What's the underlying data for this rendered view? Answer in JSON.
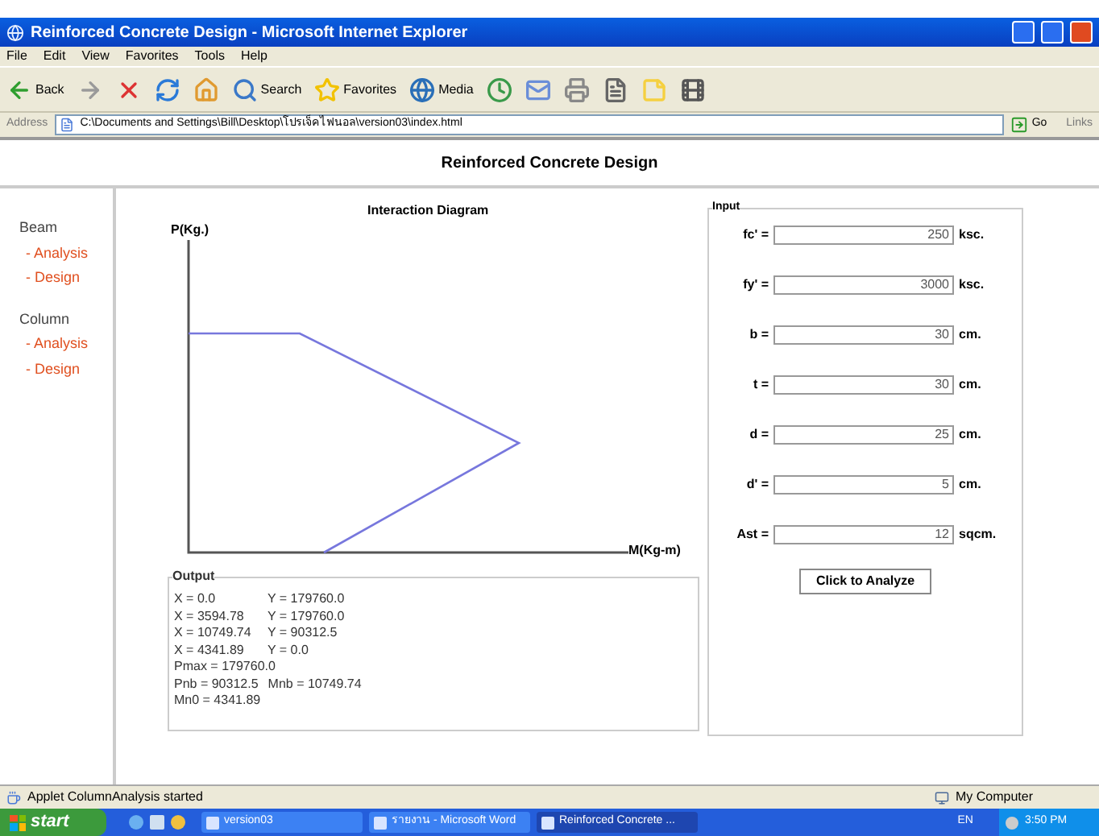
{
  "window": {
    "title": "Reinforced Concrete Design - Microsoft Internet Explorer"
  },
  "menu": [
    "File",
    "Edit",
    "View",
    "Favorites",
    "Tools",
    "Help"
  ],
  "toolbar": [
    {
      "kind": "back",
      "label": "Back"
    },
    {
      "kind": "forward"
    },
    {
      "kind": "stop"
    },
    {
      "kind": "refresh"
    },
    {
      "kind": "home"
    },
    {
      "kind": "search",
      "label": "Search"
    },
    {
      "kind": "favorites",
      "label": "Favorites"
    },
    {
      "kind": "media",
      "label": "Media"
    },
    {
      "kind": "history"
    },
    {
      "kind": "mail"
    },
    {
      "kind": "print"
    },
    {
      "kind": "edit"
    },
    {
      "kind": "note"
    },
    {
      "kind": "film"
    }
  ],
  "address": {
    "label": "Address",
    "value": "C:\\Documents and Settings\\Bill\\Desktop\\โปรเจ็คไฟนอล\\version03\\index.html",
    "go": "Go",
    "links": "Links"
  },
  "page": {
    "header": "Reinforced Concrete Design"
  },
  "sidebar": [
    {
      "title": "Beam",
      "items": [
        "- Analysis",
        "- Design"
      ]
    },
    {
      "title": "Column",
      "items": [
        "- Analysis",
        "- Design"
      ]
    }
  ],
  "diagram": {
    "title": "Interaction Diagram",
    "y_label": "P(Kg.)",
    "x_label": "M(Kg-m)"
  },
  "output": {
    "title": "Output",
    "rows": [
      [
        "X = 0.0",
        "Y = 179760.0"
      ],
      [
        "X = 3594.78",
        "Y = 179760.0"
      ],
      [
        "X = 10749.74",
        "Y = 90312.5"
      ],
      [
        "X = 4341.89",
        "Y = 0.0"
      ],
      [
        "Pmax = 179760.0"
      ],
      [
        "Pnb = 90312.5",
        "Mnb = 10749.74"
      ],
      [
        "Mn0 = 4341.89"
      ]
    ]
  },
  "input": {
    "title": "Input",
    "fields": [
      {
        "label": "fc' =",
        "value": "250",
        "unit": "ksc."
      },
      {
        "label": "fy' =",
        "value": "3000",
        "unit": "ksc."
      },
      {
        "label": "b =",
        "value": "30",
        "unit": "cm."
      },
      {
        "label": "t =",
        "value": "30",
        "unit": "cm."
      },
      {
        "label": "d =",
        "value": "25",
        "unit": "cm."
      },
      {
        "label": "d' =",
        "value": "5",
        "unit": "cm."
      },
      {
        "label": "Ast =",
        "value": "12",
        "unit": "sqcm."
      }
    ],
    "button": "Click to Analyze"
  },
  "status_bar": {
    "text": "Applet ColumnAnalysis started",
    "zone": "My Computer"
  },
  "taskbar": {
    "start": "start",
    "tasks": [
      {
        "label": "version03",
        "selected": false
      },
      {
        "label": "รายงาน - Microsoft Word",
        "selected": false
      },
      {
        "label": "Reinforced Concrete ...",
        "selected": true
      }
    ],
    "lang": "EN",
    "time": "3:50 PM"
  }
}
